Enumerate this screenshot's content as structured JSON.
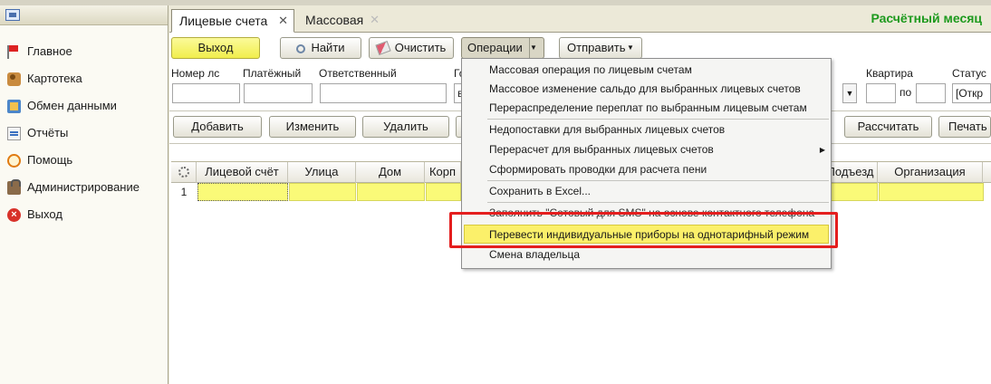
{
  "sidebar": {
    "items": [
      {
        "label": "Главное",
        "icon": "flag-icon"
      },
      {
        "label": "Картотека",
        "icon": "card-index-icon"
      },
      {
        "label": "Обмен данными",
        "icon": "data-exchange-icon"
      },
      {
        "label": "Отчёты",
        "icon": "report-icon"
      },
      {
        "label": "Помощь",
        "icon": "help-icon"
      },
      {
        "label": "Администрирование",
        "icon": "admin-icon"
      },
      {
        "label": "Выход",
        "icon": "exit-icon"
      }
    ]
  },
  "tabs": [
    {
      "label": "Лицевые счета",
      "active": true
    },
    {
      "label": "Массовая",
      "active": false
    }
  ],
  "header": {
    "month_title": "Расчётный месяц"
  },
  "toolbar": {
    "exit": "Выход",
    "find": "Найти",
    "clear": "Очистить",
    "operations": "Операции",
    "send": "Отправить"
  },
  "filters": {
    "account_no": "Номер лс",
    "payment": "Платёжный",
    "responsible": "Ответственный",
    "city_partial": "Го",
    "apartment": "Квартира",
    "apartment_to": "по",
    "status": "Статус",
    "status_value": "[Откр",
    "hidden_prefix": "в"
  },
  "actions": {
    "add": "Добавить",
    "edit": "Изменить",
    "delete": "Удалить",
    "calculate": "Рассчитать",
    "print": "Печать с"
  },
  "grid": {
    "columns": [
      "Лицевой счёт",
      "Улица",
      "Дом",
      "Корп",
      "Подъезд",
      "Организация"
    ],
    "rows": [
      {
        "num": "1"
      }
    ]
  },
  "menu": {
    "items": [
      "Массовая операция по лицевым счетам",
      "Массовое изменение сальдо для выбранных лицевых счетов",
      "Перераспределение переплат по выбранным лицевым счетам",
      "Недопоставки для выбранных лицевых счетов",
      "Перерасчет для выбранных лицевых счетов",
      "Сформировать проводки для расчета пени",
      "Сохранить в Excel...",
      "Заполнить \"Сотовый для SMS\" на основе контактного телефона",
      "Перевести индивидуальные приборы на однотарифный режим",
      "Смена владельца"
    ],
    "highlighted_index": 8
  },
  "colors": {
    "accent_yellow": "#f1ee4c",
    "month_green": "#1e9a1e",
    "annotation_red": "#e41e1e"
  }
}
